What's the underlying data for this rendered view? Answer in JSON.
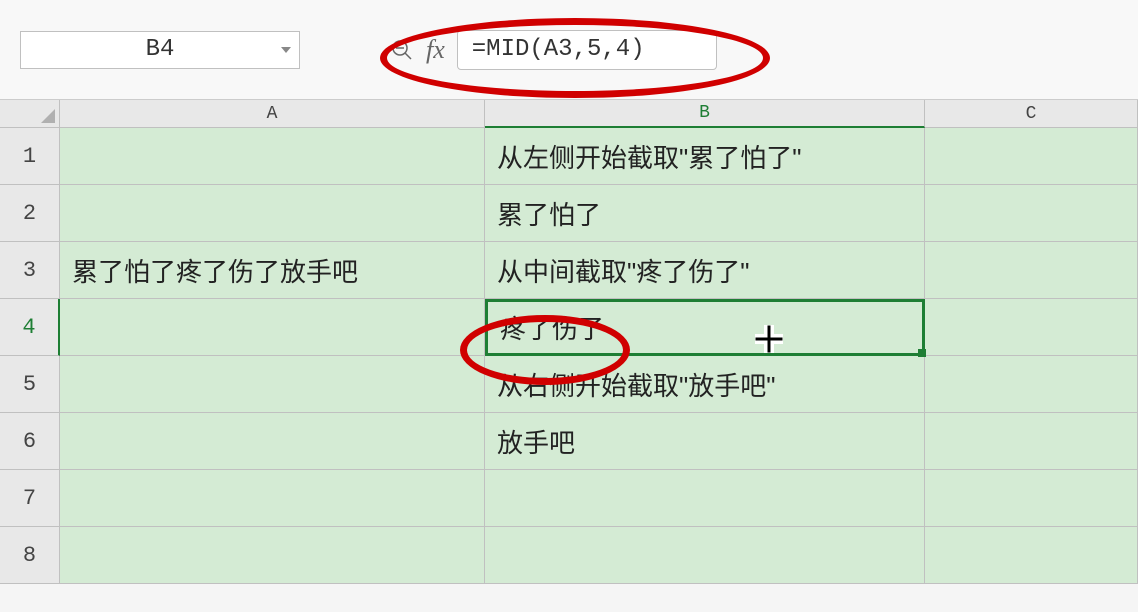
{
  "nameBox": {
    "value": "B4"
  },
  "formulaBar": {
    "fxLabel": "fx",
    "value": "=MID(A3,5,4)"
  },
  "columns": {
    "a": "A",
    "b": "B",
    "c": "C"
  },
  "rows": [
    "1",
    "2",
    "3",
    "4",
    "5",
    "6",
    "7",
    "8"
  ],
  "cells": {
    "a1": "",
    "b1": "从左侧开始截取\"累了怕了\"",
    "a2": "",
    "b2": "累了怕了",
    "a3": "累了怕了疼了伤了放手吧",
    "b3": "从中间截取\"疼了伤了\"",
    "a4": "",
    "b4": "疼了伤了",
    "a5": "",
    "b5": "从右侧开始截取\"放手吧\"",
    "a6": "",
    "b6": "放手吧",
    "a7": "",
    "b7": "",
    "a8": "",
    "b8": ""
  },
  "selectedCell": "B4"
}
